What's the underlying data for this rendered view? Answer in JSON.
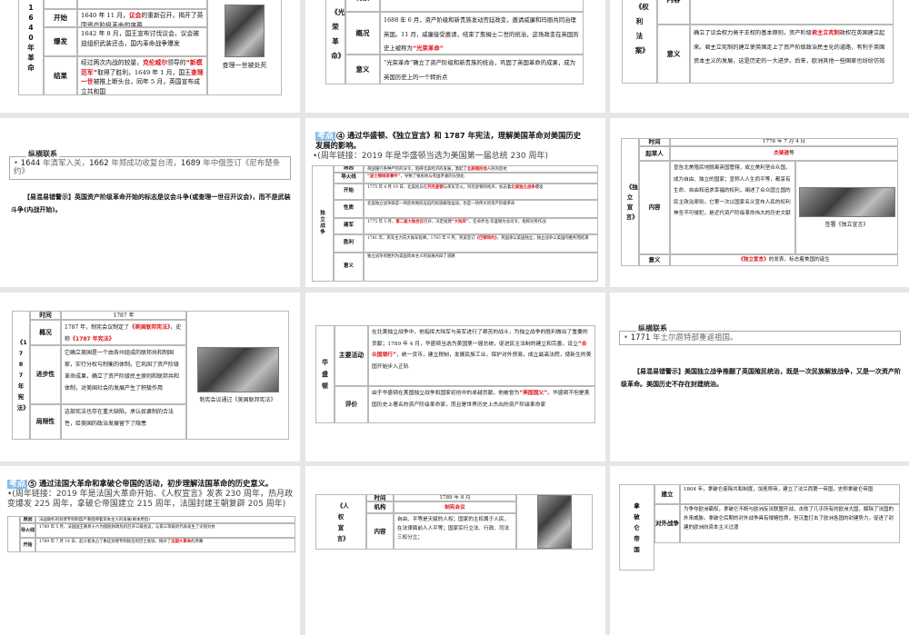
{
  "slides": [
    {
      "kind": "table",
      "table": {
        "title": "1640年革命",
        "rows": [
          {
            "label": "背景",
            "text": "重地阻碍着资本主义的发展",
            "hl": []
          },
          {
            "label": "开始",
            "text": "1640 年 11 月，议会的重新召开，揭开了英国资产阶级革命的序幕",
            "hl": [
              "议会"
            ]
          },
          {
            "label": "爆发",
            "text": "1642 年 8 月，国王宣布讨伐议会，议会被迫组织武装还击，国内革命战争爆发",
            "hl": []
          },
          {
            "label": "结果",
            "text": "经过两次内战的较量，克伦威尔领导的“新模范军”取得了胜利，1649 年 1 月，国王查理一世被推上断头台，同年 5 月，英国宣布成立共和国",
            "hl": [
              "克伦威尔",
              "“新模范军”",
              "查理一世"
            ]
          }
        ],
        "image_caption": "查理一世被处死"
      }
    },
    {
      "kind": "table",
      "table": {
        "title": "《光荣革命》",
        "rows": [
          {
            "label": "背景",
            "text": "反动政策，企图恢复天主教，复辟封建制度",
            "hl": []
          },
          {
            "label": "概况",
            "text": "1688 年 6 月，资产阶级和新贵族发动宫廷政变，邀请威廉和玛丽共同治理英国。11 月，威廉接受邀请，结束了詹姆士二世的统治，这场政变在英国历史上被称为“光荣革命”",
            "hl": [
              "“光荣革命”"
            ]
          },
          {
            "label": "意义",
            "text": "“光荣革命”确立了资产阶级和新贵族的统治，巩固了英国革命的成果，成为英国历史上的一个转折点",
            "hl": []
          }
        ]
      }
    },
    {
      "kind": "table",
      "table": {
        "title": "《权利法案》",
        "rows": [
          {
            "label": "内容",
            "text": "力，无权废除法律，征税需经议会同意，不得干涉议员的政治活动",
            "hl": []
          },
          {
            "label": "意义",
            "text": "确立了议会权力高于王权的基本原则，资产阶级君主立宪制政权在英国建立起来。君主立宪制的建立使英国走上了资产阶级政治民主化的道路，有利于英国资本主义的发展，这是历史的一大进步。后来，欧洲其他一些国家也纷纷仿效",
            "hl": [
              "君主立宪制"
            ]
          }
        ]
      }
    },
    {
      "kind": "link",
      "link": {
        "label": "纵横联系",
        "bullet_years": [
          "1644",
          "1662",
          "1689"
        ],
        "bullet": "1644 年清军入关，1662 年郑成功收复台湾，1689 年中俄签订《尼布楚条约》"
      },
      "warning": {
        "label": "【易混易错警示】",
        "text": "英国资产阶级革命开始的标志是议会斗争(或查理一世召开议会)，而不是武装斗争(内战开始)。"
      }
    },
    {
      "kind": "table",
      "header": {
        "badge": "考点",
        "num": "4",
        "title": "通过华盛顿、《独立宣言》和 1787 年宪法，理解美国革命对美国历史发展的影响。",
        "bullet": "•(周年链接：2019 年是华盛顿当选为美国第一届总统 230 周年)"
      },
      "table": {
        "title": "独立战争",
        "rows": [
          {
            "label": "原因",
            "text": "英国施行各种严厉的法令，阻碍北美经济的发展，激起了北美殖民地人民的反抗",
            "hl": [
              "北美殖民地"
            ]
          },
          {
            "label": "导火线",
            "text": "“波士顿倾茶事件”，导致了殖民地与英国矛盾的尖锐化",
            "hl": [
              "“波士顿倾茶事件”"
            ]
          },
          {
            "label": "开始",
            "text": "1775 年 4 月 19 日，北美民兵在列克星顿与英军交火，列克星顿的枪声，标志着北美独立战争爆发",
            "hl": [
              "列克星顿",
              "北美独立战争"
            ]
          },
          {
            "label": "性质",
            "text": "北美独立战争既是一场反抗殖民压迫的民族解放运动，也是一场伟大的资产阶级革命",
            "hl": []
          },
          {
            "label": "建军",
            "text": "1775 年 5 月，第二届大陆会议召开，决定组建“大陆军”，任命乔治·华盛顿为总司令，指挥对英作战",
            "hl": [
              "第二届大陆会议",
              "“大陆军”"
            ]
          },
          {
            "label": "胜利",
            "text": "1781 年，英军主力向大陆军投降。1783 年 9 月，英美签订《巴黎和约》，英国承认美国独立，独立战争以美国的胜利而结束",
            "hl": [
              "《巴黎和约》"
            ]
          },
          {
            "label": "意义",
            "text": "独立战争的胜利为美国资本主义的发展开辟了道路",
            "hl": []
          }
        ]
      }
    },
    {
      "kind": "table",
      "table": {
        "title": "《独立宣言》",
        "rows": [
          {
            "label": "时间",
            "text": "1776 年 7 月 4 日",
            "hl": [],
            "center": true
          },
          {
            "label": "起草人",
            "text": "杰斐逊等",
            "hl": [
              "杰斐逊"
            ],
            "center": true
          },
          {
            "label": "内容",
            "text": "宣告北美殖民地脱离英国管辖，成立美利坚合众国，成为自由、独立的国家；宣称人人生而平等，都享有生命、自由和追求幸福的权利，阐述了合众国立国的民主政治原则。它第一次以国家名义宣布人民的权利神圣不可侵犯，是近代资产阶级革命伟大的历史文献",
            "hl": []
          },
          {
            "label": "意义",
            "text": "《独立宣言》的发表，标志着美国的诞生",
            "hl": [
              "《独立宣言》"
            ],
            "center": true
          }
        ],
        "image_caption": "签署《独立宣言》"
      }
    },
    {
      "kind": "table",
      "table": {
        "title": "《1787年宪法》",
        "rows": [
          {
            "label": "时间",
            "text": "1787 年",
            "hl": [],
            "center": true
          },
          {
            "label": "概况",
            "text": "1787 年，制宪会议制定了《美国联邦宪法》，史称《1787 年宪法》",
            "hl": [
              "《美国联邦宪法》",
              "《1787 年宪法》"
            ]
          },
          {
            "label": "进步性",
            "text": "它确立美国是一个由各州组成的联邦共和制国家，实行分权与制衡的体制。它巩固了资产阶级革命成果，确立了资产阶级民主原则和联邦共和体制，对美国社会的发展产生了积极作用",
            "hl": []
          },
          {
            "label": "局限性",
            "text": "这部宪法也存在重大缺陷，承认奴隶制的合法性，给美国的政治发展留下了隐患",
            "hl": []
          }
        ],
        "image_caption": "制宪会议通过《美国联邦宪法》"
      }
    },
    {
      "kind": "table",
      "table": {
        "title": "华盛顿",
        "rows": [
          {
            "label": "主要活动",
            "text": "在北美独立战争中，他指挥大陆军与英军进行了艰苦的战斗，为独立战争的胜利做出了重要的贡献；1789 年 4 月，华盛顿当选为美国第一届总统，促进民主法制的建立和完善，设立“合众国银行”，统一货币，建立税制，发展民族工业，保护对外贸易，成立最高法院，使新生的美国开始步入正轨",
            "hl": [
              "“合众国银行”"
            ]
          },
          {
            "label": "评价",
            "text": "由于华盛顿在美国独立战争和国家初创中的卓越贡献，他被誉为“美国国父”。华盛顿不但是美国历史上著名的资产阶级革命家，而且是世界历史上杰出的资产阶级革命家",
            "hl": [
              "“美国国父”"
            ]
          }
        ]
      }
    },
    {
      "kind": "link",
      "link": {
        "label": "纵横联系",
        "bullet_years": [
          "1771"
        ],
        "bullet": "1771 年土尔扈特部重返祖国。"
      },
      "warning": {
        "label": "【易混易错警示】",
        "text": "美国独立战争推翻了英国殖民统治，既是一次民族解放战争，又是一次资产阶级革命。美国历史不存在封建统治。"
      }
    },
    {
      "kind": "table",
      "header": {
        "badge": "考点",
        "num": "5",
        "title": "通过法国大革命和拿破仑帝国的活动，初步理解法国革命的历史意义。",
        "bullet": "•(周年链接：2019 年是法国大革命开始、《人权宣言》发表 230 周年，热月政变爆发 225 周年，拿破仑帝国建立 215 周年，法国封建王朝复辟 205 周年)"
      },
      "table": {
        "title": "",
        "rows": [
          {
            "label": "原因",
            "text": "法国腐朽的封建专制制度严重阻碍着资本主义的发展(根本原因)",
            "hl": []
          },
          {
            "label": "导火线",
            "text": "1789 年 5 月，法国国王路易十六为摆脱财政危机召开三级会议，与第三等级的代表发生了尖锐对抗",
            "hl": []
          },
          {
            "label": "开始",
            "text": "1789 年 7 月 14 日，起义者攻占了象征封建专制统治的巴士底狱，揭开了法国大革命的序幕",
            "hl": [
              "法国大革命"
            ]
          }
        ]
      }
    },
    {
      "kind": "table",
      "table": {
        "title": "《人权宣言》",
        "rows": [
          {
            "label": "时间",
            "text": "1789 年 8 月",
            "hl": [],
            "center": true
          },
          {
            "label": "机构",
            "text": "制宪会议",
            "hl": [
              "制宪会议"
            ],
            "center": true
          },
          {
            "label": "内容",
            "text": "自由、平等是天赋的人权；国家的主权属于人民，在法律面前人人平等；国家实行立法、行政、司法三权分立；",
            "hl": []
          }
        ],
        "image_caption": ""
      }
    },
    {
      "kind": "table",
      "table": {
        "title": "拿破仑帝国",
        "rows": [
          {
            "label": "建立",
            "text": "1804 年，拿破仑废除共和制度，加冕称帝，建立了法兰西第一帝国，史称拿破仑帝国",
            "hl": []
          },
          {
            "label": "对外战争",
            "text": "为争夺欧洲霸权，拿破仑不断与欧洲反法联盟开战，击败了几乎所有的欧洲大国，解除了法国的外来威胁。拿破仑后期的对外战争具有侵略性质，但沉重打击了欧洲各国的封建势力，促进了封建的欧洲向资本主义过渡",
            "hl": []
          }
        ]
      }
    }
  ]
}
